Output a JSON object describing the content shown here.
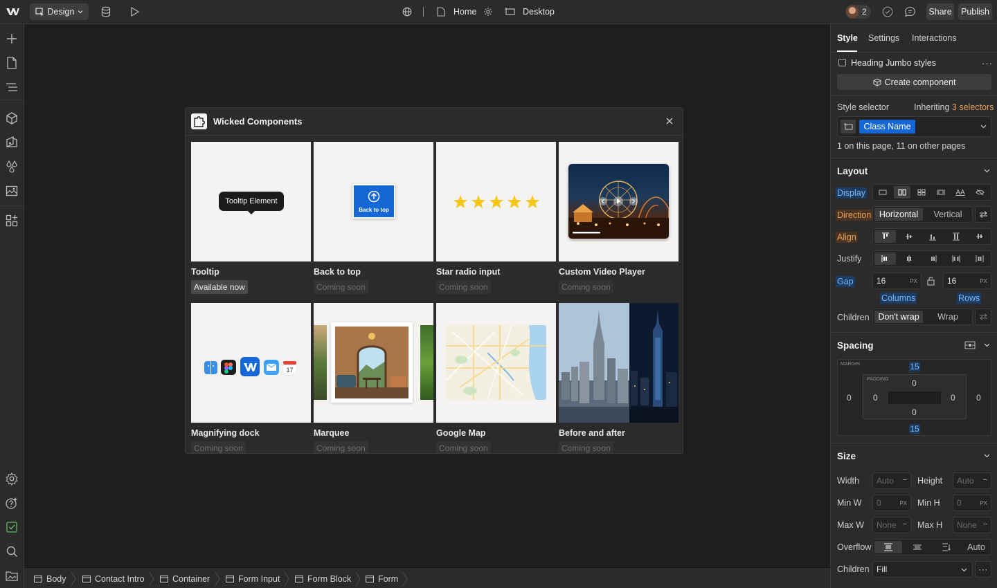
{
  "topbar": {
    "mode_label": "Design",
    "page_label": "Home",
    "breakpoint_label": "Desktop",
    "collaborators_count": "2",
    "share_label": "Share",
    "publish_label": "Publish"
  },
  "modal": {
    "title": "Wicked Components",
    "items": [
      {
        "title": "Tooltip",
        "status": "Available now",
        "preview_text": "Tooltip Element"
      },
      {
        "title": "Back to top",
        "status": "Coming soon",
        "preview_text": "Back to top"
      },
      {
        "title": "Star radio input",
        "status": "Coming soon"
      },
      {
        "title": "Custom Video Player",
        "status": "Coming soon"
      },
      {
        "title": "Magnifying dock",
        "status": "Coming soon"
      },
      {
        "title": "Marquee",
        "status": "Coming soon"
      },
      {
        "title": "Google Map",
        "status": "Coming soon"
      },
      {
        "title": "Before and after",
        "status": "Coming soon"
      }
    ]
  },
  "panel": {
    "tabs": [
      "Style",
      "Settings",
      "Interactions"
    ],
    "heading_checkbox_label": "Heading Jumbo styles",
    "create_component_label": "Create component",
    "style_selector_label": "Style selector",
    "inheriting_prefix": "Inheriting",
    "inheriting_link": "3 selectors",
    "class_name": "Class Name",
    "usage_text": "1 on this page, 11 on other pages",
    "layout": {
      "title": "Layout",
      "display_label": "Display",
      "direction_label": "Direction",
      "direction_options": [
        "Horizontal",
        "Vertical"
      ],
      "align_label": "Align",
      "justify_label": "Justify",
      "gap_label": "Gap",
      "gap_columns": "16",
      "gap_rows": "16",
      "gap_unit": "PX",
      "columns_label": "Columns",
      "rows_label": "Rows",
      "children_label": "Children",
      "children_options": [
        "Don't wrap",
        "Wrap"
      ]
    },
    "spacing": {
      "title": "Spacing",
      "margin_label": "MARGIN",
      "padding_label": "PADDING",
      "margin_top": "15",
      "margin_bottom": "15",
      "margin_left": "0",
      "margin_right": "0",
      "padding_top": "0",
      "padding_bottom": "0",
      "padding_left": "0",
      "padding_right": "0"
    },
    "size": {
      "title": "Size",
      "width_label": "Width",
      "height_label": "Height",
      "min_w_label": "Min W",
      "min_h_label": "Min H",
      "max_w_label": "Max W",
      "max_h_label": "Max H",
      "auto": "Auto",
      "none": "None",
      "zero": "0",
      "px": "PX",
      "overflow_label": "Overflow",
      "overflow_auto": "Auto",
      "children_label": "Children",
      "children_value": "Fill"
    }
  },
  "breadcrumbs": [
    "Body",
    "Contact Intro",
    "Container",
    "Form Input",
    "Form Block",
    "Form"
  ],
  "colors": {
    "accent_blue": "#1467d4",
    "accent_orange": "#e8a058",
    "star_yellow": "#f5c518"
  }
}
